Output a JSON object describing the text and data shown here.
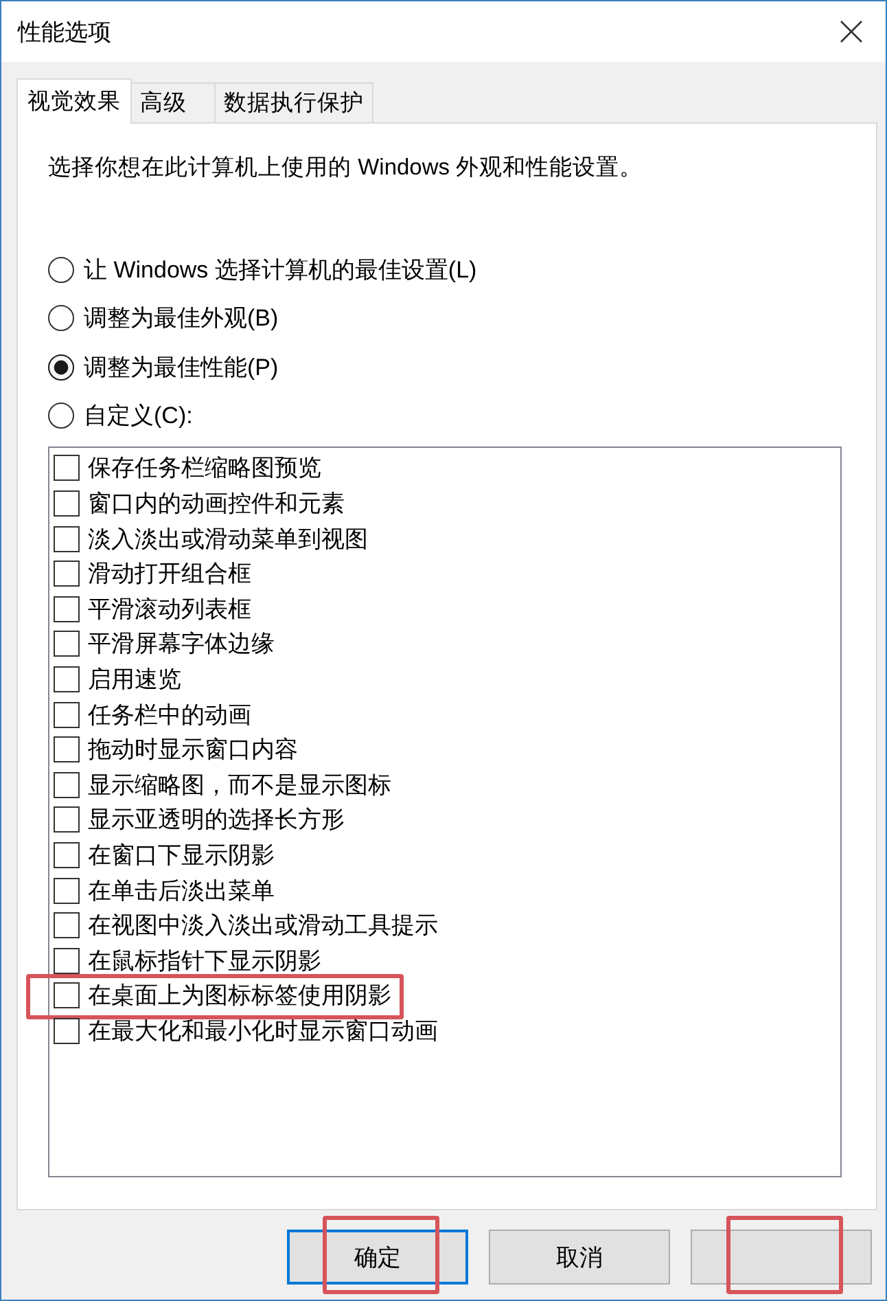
{
  "window": {
    "title": "性能选项"
  },
  "tabs": [
    {
      "label": "视觉效果",
      "selected": true
    },
    {
      "label": "高级",
      "selected": false
    },
    {
      "label": "数据执行保护",
      "selected": false
    }
  ],
  "description": "选择你想在此计算机上使用的 Windows 外观和性能设置。",
  "options": [
    {
      "label": "让 Windows 选择计算机的最佳设置(L)",
      "selected": false
    },
    {
      "label": "调整为最佳外观(B)",
      "selected": false
    },
    {
      "label": "调整为最佳性能(P)",
      "selected": true
    },
    {
      "label": "自定义(C):",
      "selected": false
    }
  ],
  "effects": [
    {
      "label": "保存任务栏缩略图预览",
      "checked": false,
      "highlighted": false
    },
    {
      "label": "窗口内的动画控件和元素",
      "checked": false,
      "highlighted": false
    },
    {
      "label": "淡入淡出或滑动菜单到视图",
      "checked": false,
      "highlighted": false
    },
    {
      "label": "滑动打开组合框",
      "checked": false,
      "highlighted": false
    },
    {
      "label": "平滑滚动列表框",
      "checked": false,
      "highlighted": false
    },
    {
      "label": "平滑屏幕字体边缘",
      "checked": false,
      "highlighted": false
    },
    {
      "label": "启用速览",
      "checked": false,
      "highlighted": false
    },
    {
      "label": "任务栏中的动画",
      "checked": false,
      "highlighted": false
    },
    {
      "label": "拖动时显示窗口内容",
      "checked": false,
      "highlighted": false
    },
    {
      "label": "显示缩略图，而不是显示图标",
      "checked": false,
      "highlighted": false
    },
    {
      "label": "显示亚透明的选择长方形",
      "checked": false,
      "highlighted": false
    },
    {
      "label": "在窗口下显示阴影",
      "checked": false,
      "highlighted": false
    },
    {
      "label": "在单击后淡出菜单",
      "checked": false,
      "highlighted": false
    },
    {
      "label": "在视图中淡入淡出或滑动工具提示",
      "checked": false,
      "highlighted": false
    },
    {
      "label": "在鼠标指针下显示阴影",
      "checked": false,
      "highlighted": false
    },
    {
      "label": "在桌面上为图标标签使用阴影",
      "checked": false,
      "highlighted": true
    },
    {
      "label": "在最大化和最小化时显示窗口动画",
      "checked": false,
      "highlighted": false
    }
  ],
  "buttons": [
    {
      "label": "确定",
      "default": true,
      "highlighted": true
    },
    {
      "label": "取消",
      "default": false,
      "highlighted": false
    },
    {
      "default": false,
      "highlighted": true
    }
  ]
}
